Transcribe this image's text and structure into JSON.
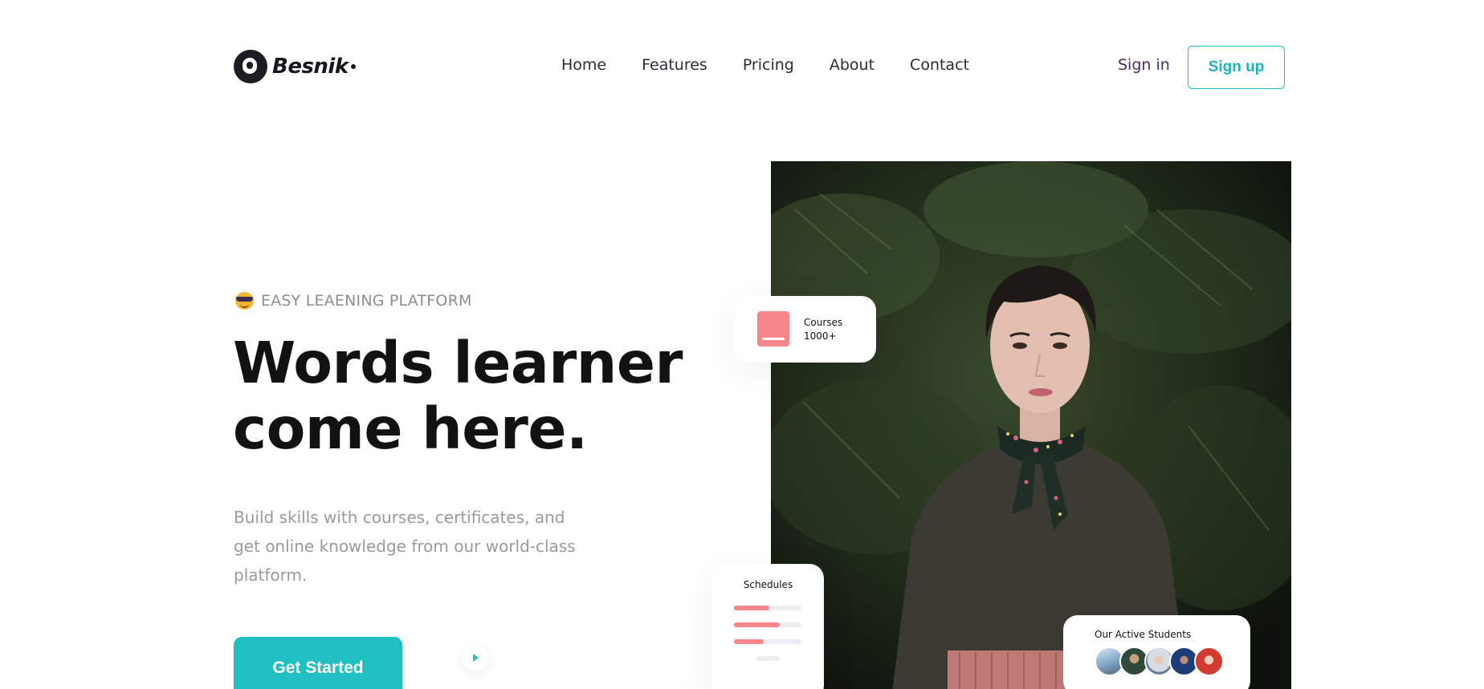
{
  "brand": {
    "name": "Besnik"
  },
  "nav": {
    "items": [
      {
        "label": "Home"
      },
      {
        "label": "Features"
      },
      {
        "label": "Pricing"
      },
      {
        "label": "About"
      },
      {
        "label": "Contact"
      }
    ]
  },
  "auth": {
    "signin_label": "Sign in",
    "signup_label": "Sign up"
  },
  "hero": {
    "eyebrow_icon": "sunglasses-emoji-icon",
    "eyebrow": "EASY LEAENING PLATFORM",
    "headline_line1": "Words learner",
    "headline_line2": "come here.",
    "description": "Build skills with courses, certificates, and get online knowledge from our world-class platform.",
    "cta_label": "Get Started",
    "play_icon": "play-icon"
  },
  "cards": {
    "courses": {
      "title": "Courses",
      "count": "1000+",
      "icon": "book-icon"
    },
    "schedules": {
      "title": "Schedules",
      "progress": [
        0.52,
        0.68,
        0.44
      ]
    },
    "students": {
      "title": "Our Active Students",
      "avatar_count": 5
    }
  },
  "colors": {
    "accent": "#20bfc2",
    "coral": "#f6868a",
    "headline": "#121212",
    "muted": "#9a9a9a",
    "signin": "#4a2a63"
  }
}
